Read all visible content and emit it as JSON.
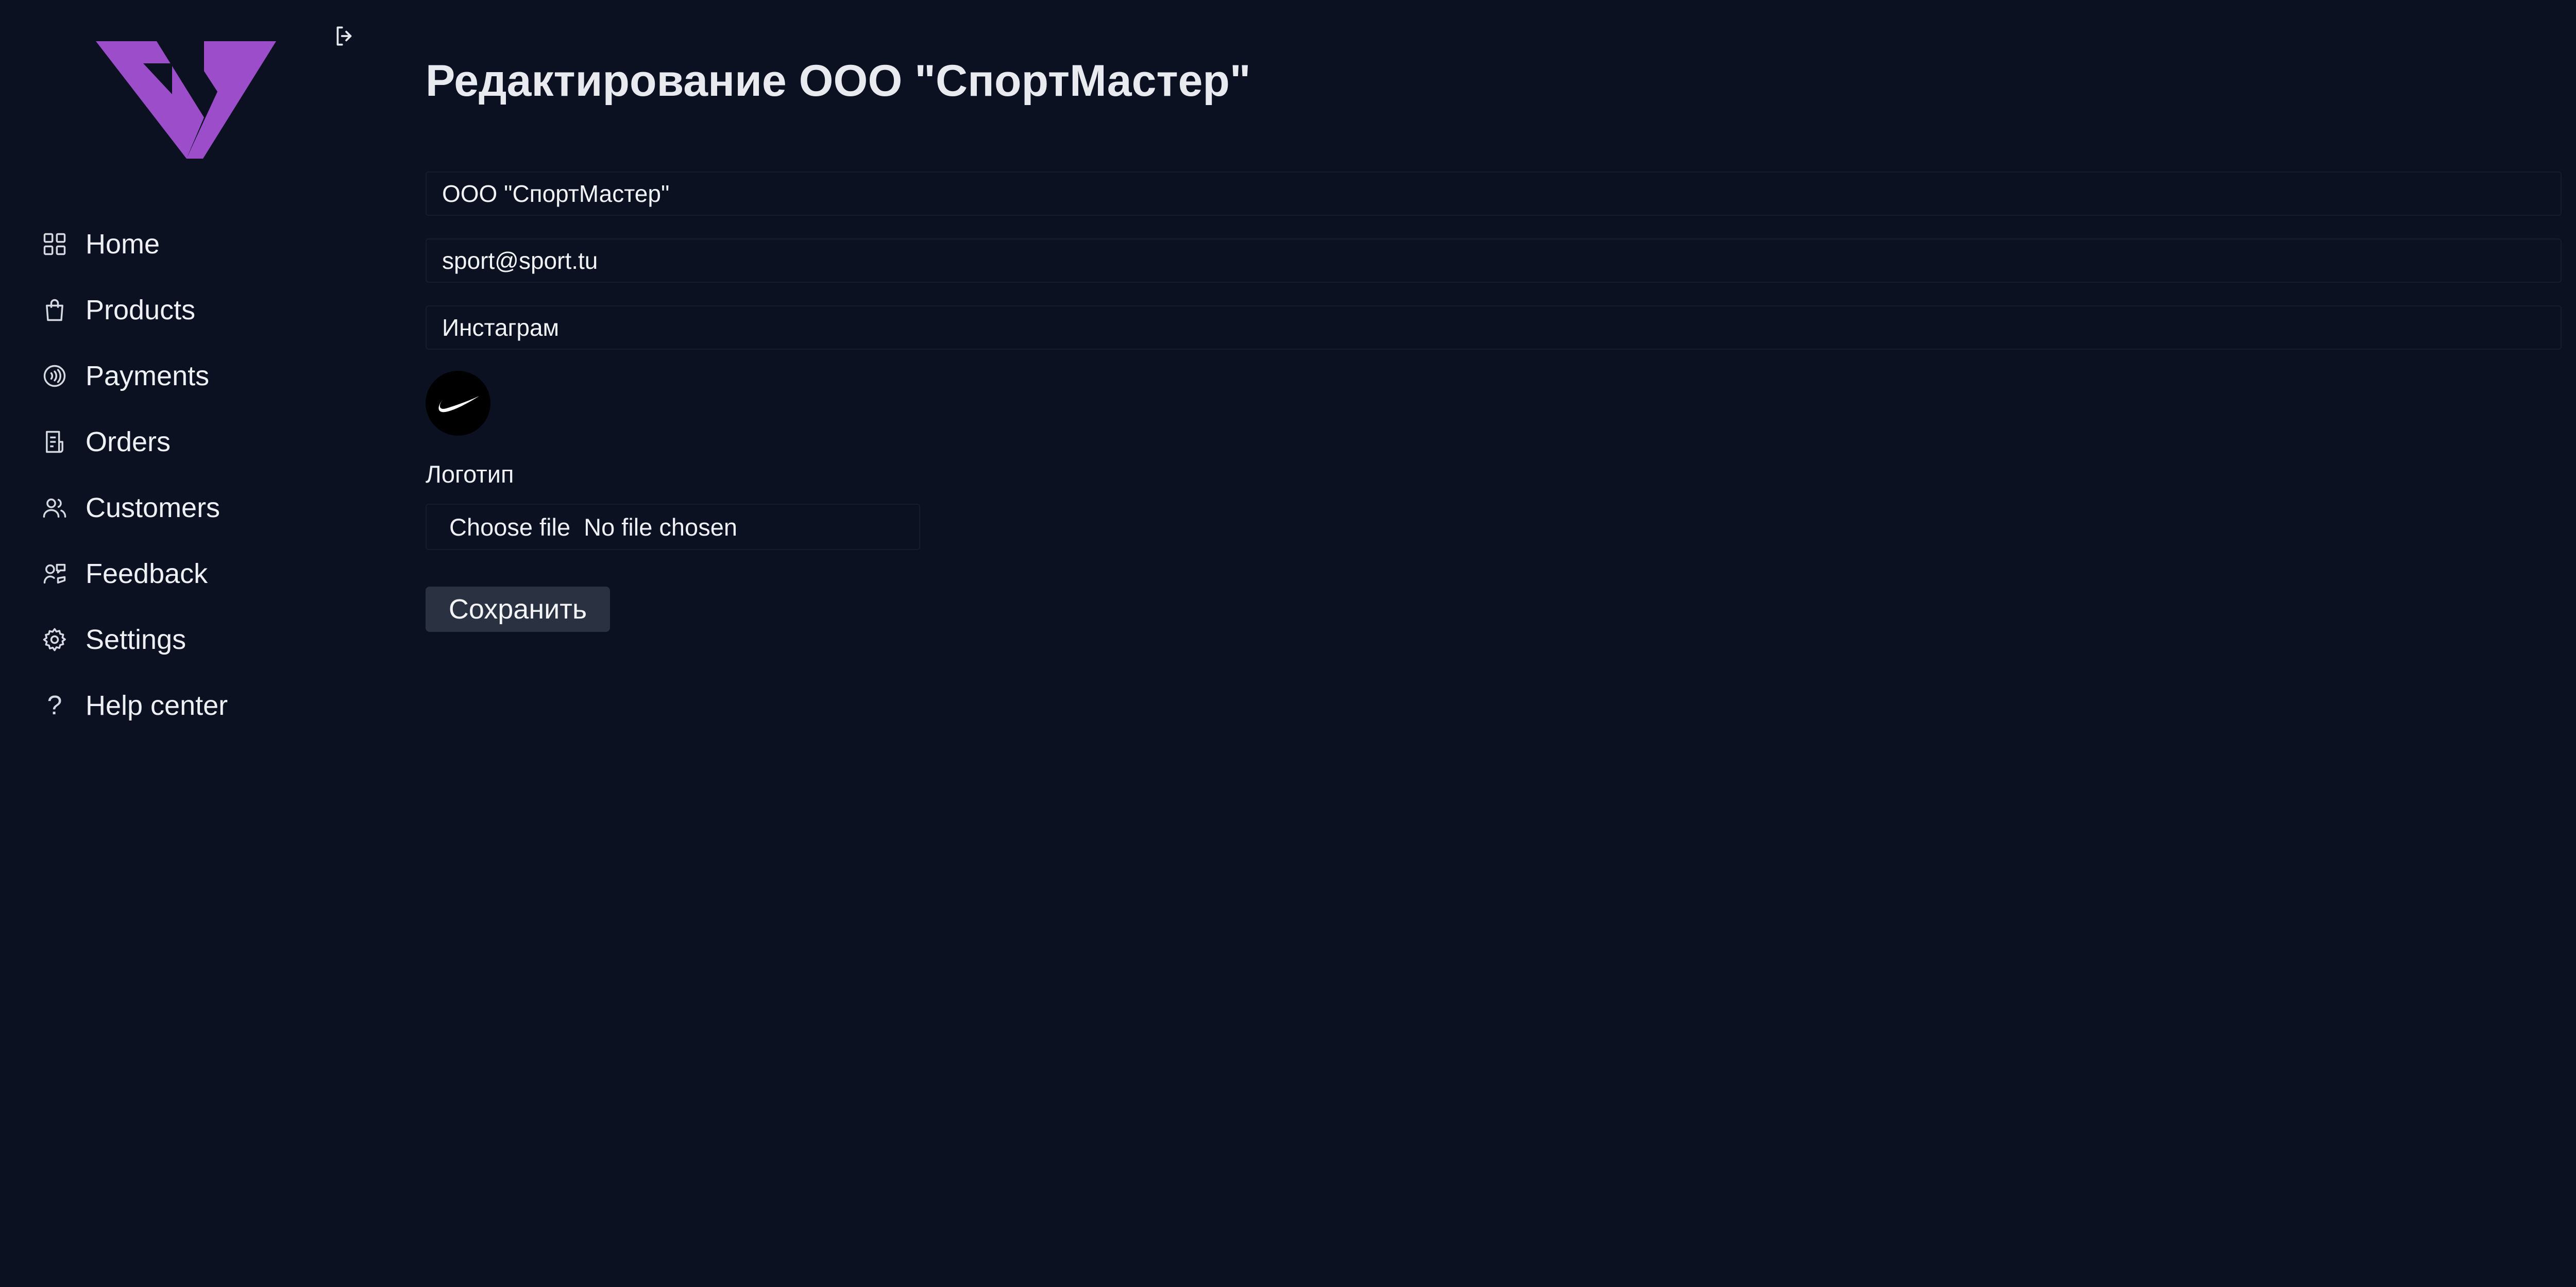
{
  "brand": {
    "logo_icon": "brand-logo",
    "accent_color": "#9b4dca"
  },
  "sidebar": {
    "logout_icon": "logout-icon",
    "items": [
      {
        "label": "Home",
        "icon": "grid-icon"
      },
      {
        "label": "Products",
        "icon": "shopping-bag-icon"
      },
      {
        "label": "Payments",
        "icon": "contactless-icon"
      },
      {
        "label": "Orders",
        "icon": "receipt-icon"
      },
      {
        "label": "Customers",
        "icon": "users-icon"
      },
      {
        "label": "Feedback",
        "icon": "feedback-icon"
      },
      {
        "label": "Settings",
        "icon": "gear-icon"
      },
      {
        "label": "Help center",
        "icon": "question-icon",
        "glyph": "?"
      }
    ]
  },
  "main": {
    "title": "Редактирование ООО \"СпортМастер\"",
    "form": {
      "name_value": "ООО \"СпортМастер\"",
      "email_value": "sport@sport.tu",
      "social_value": "Инстаграм",
      "logo_label": "Логотип",
      "file_button_label": "Choose file",
      "file_status": "No file chosen",
      "save_label": "Сохранить"
    }
  }
}
